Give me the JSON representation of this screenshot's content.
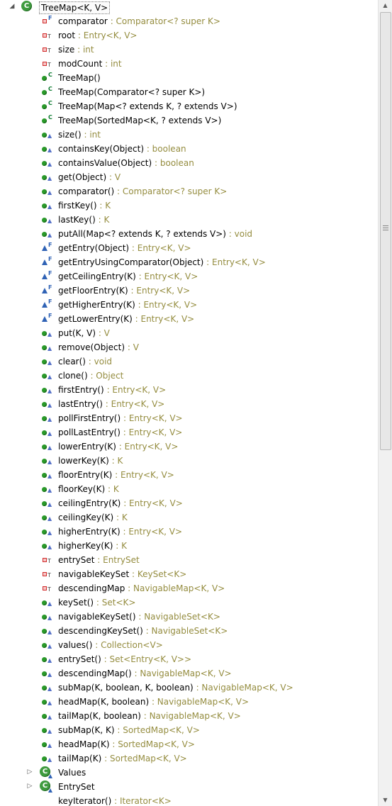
{
  "root": {
    "name": "TreeMap<K, V>",
    "expanded": true
  },
  "members": [
    {
      "kind": "field-private",
      "mod": "F",
      "name": "comparator",
      "type": "Comparator<? super K>"
    },
    {
      "kind": "field-private",
      "mod": "T",
      "name": "root",
      "type": "Entry<K, V>"
    },
    {
      "kind": "field-private",
      "mod": "T",
      "name": "size",
      "type": "int"
    },
    {
      "kind": "field-private",
      "mod": "T",
      "name": "modCount",
      "type": "int"
    },
    {
      "kind": "ctor",
      "mod": "C",
      "name": "TreeMap()",
      "type": ""
    },
    {
      "kind": "ctor",
      "mod": "C",
      "name": "TreeMap(Comparator<? super K>)",
      "type": ""
    },
    {
      "kind": "ctor",
      "mod": "C",
      "name": "TreeMap(Map<? extends K, ? extends V>)",
      "type": ""
    },
    {
      "kind": "ctor",
      "mod": "C",
      "name": "TreeMap(SortedMap<K, ? extends V>)",
      "type": ""
    },
    {
      "kind": "method",
      "mod": "A",
      "name": "size()",
      "type": "int"
    },
    {
      "kind": "method",
      "mod": "A",
      "name": "containsKey(Object)",
      "type": "boolean"
    },
    {
      "kind": "method",
      "mod": "A",
      "name": "containsValue(Object)",
      "type": "boolean"
    },
    {
      "kind": "method",
      "mod": "A",
      "name": "get(Object)",
      "type": "V"
    },
    {
      "kind": "method",
      "mod": "A",
      "name": "comparator()",
      "type": "Comparator<? super K>"
    },
    {
      "kind": "method",
      "mod": "A",
      "name": "firstKey()",
      "type": "K"
    },
    {
      "kind": "method",
      "mod": "A",
      "name": "lastKey()",
      "type": "K"
    },
    {
      "kind": "method",
      "mod": "A",
      "name": "putAll(Map<? extends K, ? extends V>)",
      "type": "void"
    },
    {
      "kind": "method-final",
      "mod": "F",
      "name": "getEntry(Object)",
      "type": "Entry<K, V>"
    },
    {
      "kind": "method-final",
      "mod": "F",
      "name": "getEntryUsingComparator(Object)",
      "type": "Entry<K, V>"
    },
    {
      "kind": "method-final",
      "mod": "F",
      "name": "getCeilingEntry(K)",
      "type": "Entry<K, V>"
    },
    {
      "kind": "method-final",
      "mod": "F",
      "name": "getFloorEntry(K)",
      "type": "Entry<K, V>"
    },
    {
      "kind": "method-final",
      "mod": "F",
      "name": "getHigherEntry(K)",
      "type": "Entry<K, V>"
    },
    {
      "kind": "method-final",
      "mod": "F",
      "name": "getLowerEntry(K)",
      "type": "Entry<K, V>"
    },
    {
      "kind": "method",
      "mod": "A",
      "name": "put(K, V)",
      "type": "V"
    },
    {
      "kind": "method",
      "mod": "A",
      "name": "remove(Object)",
      "type": "V"
    },
    {
      "kind": "method",
      "mod": "A",
      "name": "clear()",
      "type": "void"
    },
    {
      "kind": "method",
      "mod": "A",
      "name": "clone()",
      "type": "Object"
    },
    {
      "kind": "method",
      "mod": "A",
      "name": "firstEntry()",
      "type": "Entry<K, V>"
    },
    {
      "kind": "method",
      "mod": "A",
      "name": "lastEntry()",
      "type": "Entry<K, V>"
    },
    {
      "kind": "method",
      "mod": "A",
      "name": "pollFirstEntry()",
      "type": "Entry<K, V>"
    },
    {
      "kind": "method",
      "mod": "A",
      "name": "pollLastEntry()",
      "type": "Entry<K, V>"
    },
    {
      "kind": "method",
      "mod": "A",
      "name": "lowerEntry(K)",
      "type": "Entry<K, V>"
    },
    {
      "kind": "method",
      "mod": "A",
      "name": "lowerKey(K)",
      "type": "K"
    },
    {
      "kind": "method",
      "mod": "A",
      "name": "floorEntry(K)",
      "type": "Entry<K, V>"
    },
    {
      "kind": "method",
      "mod": "A",
      "name": "floorKey(K)",
      "type": "K"
    },
    {
      "kind": "method",
      "mod": "A",
      "name": "ceilingEntry(K)",
      "type": "Entry<K, V>"
    },
    {
      "kind": "method",
      "mod": "A",
      "name": "ceilingKey(K)",
      "type": "K"
    },
    {
      "kind": "method",
      "mod": "A",
      "name": "higherEntry(K)",
      "type": "Entry<K, V>"
    },
    {
      "kind": "method",
      "mod": "A",
      "name": "higherKey(K)",
      "type": "K"
    },
    {
      "kind": "field-private",
      "mod": "T",
      "name": "entrySet",
      "type": "EntrySet"
    },
    {
      "kind": "field-private",
      "mod": "T",
      "name": "navigableKeySet",
      "type": "KeySet<K>"
    },
    {
      "kind": "field-private",
      "mod": "T",
      "name": "descendingMap",
      "type": "NavigableMap<K, V>"
    },
    {
      "kind": "method",
      "mod": "A",
      "name": "keySet()",
      "type": "Set<K>"
    },
    {
      "kind": "method",
      "mod": "A",
      "name": "navigableKeySet()",
      "type": "NavigableSet<K>"
    },
    {
      "kind": "method",
      "mod": "A",
      "name": "descendingKeySet()",
      "type": "NavigableSet<K>"
    },
    {
      "kind": "method",
      "mod": "A",
      "name": "values()",
      "type": "Collection<V>"
    },
    {
      "kind": "method",
      "mod": "A",
      "name": "entrySet()",
      "type": "Set<Entry<K, V>>"
    },
    {
      "kind": "method",
      "mod": "A",
      "name": "descendingMap()",
      "type": "NavigableMap<K, V>"
    },
    {
      "kind": "method",
      "mod": "A",
      "name": "subMap(K, boolean, K, boolean)",
      "type": "NavigableMap<K, V>"
    },
    {
      "kind": "method",
      "mod": "A",
      "name": "headMap(K, boolean)",
      "type": "NavigableMap<K, V>"
    },
    {
      "kind": "method",
      "mod": "A",
      "name": "tailMap(K, boolean)",
      "type": "NavigableMap<K, V>"
    },
    {
      "kind": "method",
      "mod": "A",
      "name": "subMap(K, K)",
      "type": "SortedMap<K, V>"
    },
    {
      "kind": "method",
      "mod": "A",
      "name": "headMap(K)",
      "type": "SortedMap<K, V>"
    },
    {
      "kind": "method",
      "mod": "A",
      "name": "tailMap(K)",
      "type": "SortedMap<K, V>"
    }
  ],
  "inner_classes": [
    {
      "name": "Values",
      "icon": "class-icon"
    },
    {
      "name": "EntrySet",
      "icon": "class-icon"
    }
  ],
  "partial_row": {
    "name": "keyIterator()",
    "type": "Iterator<K>"
  },
  "separator": " : "
}
